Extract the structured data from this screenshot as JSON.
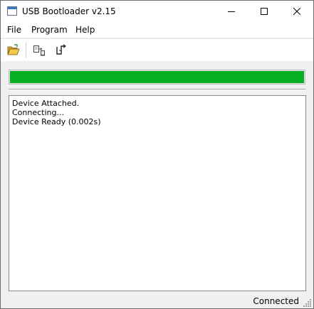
{
  "window": {
    "title": "USB Bootloader v2.15",
    "icon": "app-window-icon"
  },
  "controls": {
    "minimize_icon": "minimize-icon",
    "maximize_icon": "maximize-icon",
    "close_icon": "close-icon"
  },
  "menu": {
    "items": [
      "File",
      "Program",
      "Help"
    ]
  },
  "toolbar": {
    "buttons": [
      {
        "icon": "open-folder-icon"
      },
      {
        "icon": "program-device-icon"
      },
      {
        "icon": "reset-signal-icon"
      }
    ]
  },
  "progress": {
    "value_percent": 100,
    "color": "#06b025"
  },
  "log": {
    "lines": [
      "Device Attached.",
      "Connecting...",
      "Device Ready (0.002s)"
    ]
  },
  "status": {
    "text": "Connected"
  }
}
